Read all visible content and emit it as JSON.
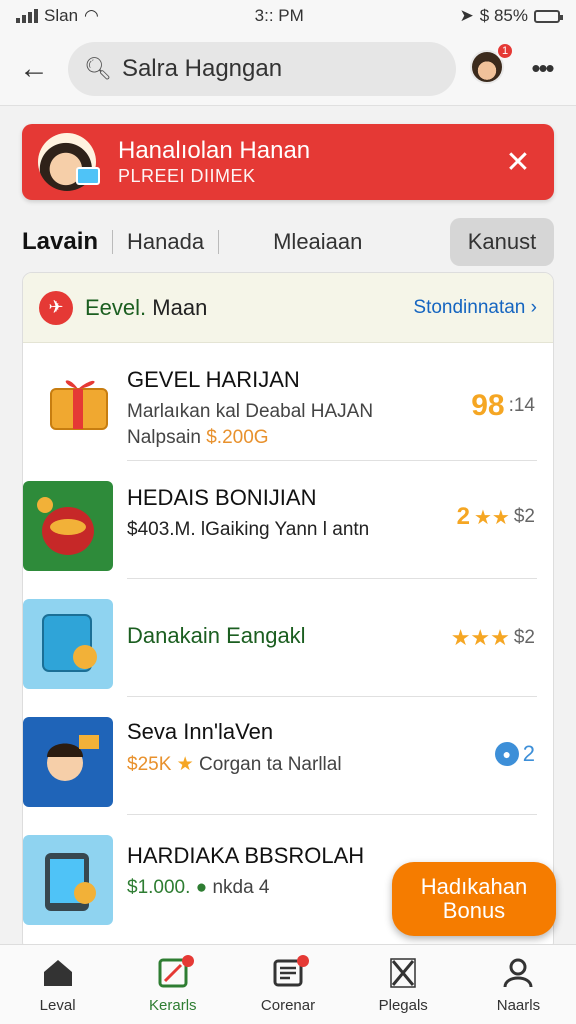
{
  "status_bar": {
    "carrier": "Slan",
    "time": "3:: PM",
    "battery": "$ 85%"
  },
  "header": {
    "search_value": "Salra Hagngan",
    "notification_count": "1"
  },
  "banner": {
    "title": "Hanalıolan Hanan",
    "subtitle": "PLREEI DIIMEK"
  },
  "tabs": [
    {
      "label": "Lavain"
    },
    {
      "label": "Hanada"
    },
    {
      "label": "Mleaiaan"
    },
    {
      "label": "Kanust"
    }
  ],
  "list": {
    "header_title_colored": "Eevel.",
    "header_title_rest": " Maan",
    "header_link": "Stondinnatan",
    "items": [
      {
        "title": "GEVEL HARIJAN",
        "line1": "Marlaıkan kal Deabal HAJAN",
        "line2_prefix": "Nalpsain ",
        "line2_price": "$.200G",
        "right_main": "98",
        "right_sub": ":14"
      },
      {
        "title": "HEDAIS BONIJIAN",
        "line1": "$403.M.  lGaiking Yann l antn",
        "rating": "2",
        "right_sub": "$2"
      },
      {
        "title": "Danakain Eangakl",
        "right_sub": "$2"
      },
      {
        "title": "Seva Inn'laVen",
        "price": "$25K",
        "line1": "Corgan ta Narllal",
        "right_sub": "2"
      },
      {
        "title": "HARDIAKA BBSROLAH",
        "price": "$1.000.",
        "line1": "nkda 4"
      }
    ]
  },
  "fab": {
    "line1": "Hadıkahan",
    "line2": "Bonus"
  },
  "bottom_nav": [
    {
      "label": "Leval"
    },
    {
      "label": "Kerarls"
    },
    {
      "label": "Corenar"
    },
    {
      "label": "Plegals"
    },
    {
      "label": "Naarls"
    }
  ],
  "colors": {
    "banner": "#e53935",
    "accent_green": "#2e7d32",
    "fab": "#f57c00",
    "rating_star": "#f5a623"
  }
}
